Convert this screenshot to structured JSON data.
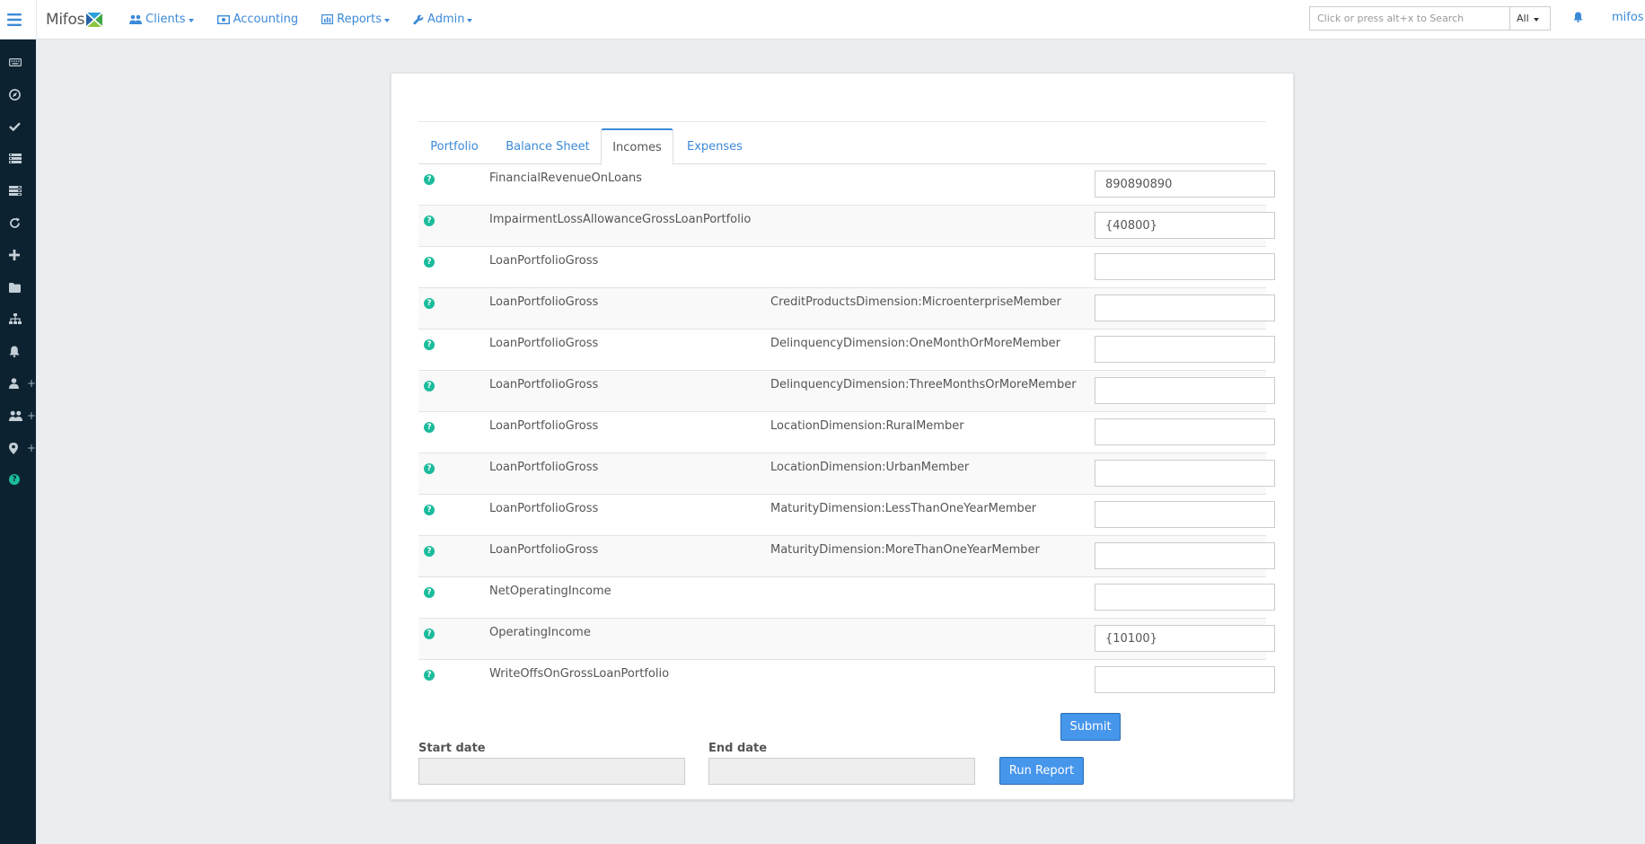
{
  "nav": {
    "brand": "Mifos",
    "items": [
      {
        "label": "Clients",
        "icon": "users-icon"
      },
      {
        "label": "Accounting",
        "icon": "money-icon"
      },
      {
        "label": "Reports",
        "icon": "bar-chart-icon"
      },
      {
        "label": "Admin",
        "icon": "wrench-icon"
      }
    ],
    "search_placeholder": "Click or press alt+x to Search",
    "search_scope": "All",
    "user": "mifos"
  },
  "sidebar": {
    "icons": [
      "keyboard-icon",
      "compass-icon",
      "check-icon",
      "list-icon",
      "list-alt-icon",
      "refresh-icon",
      "plus-icon",
      "folder-icon",
      "sitemap-icon",
      "bell-icon",
      "user-plus-icon",
      "users-plus-icon",
      "map-marker-plus-icon",
      "question-icon"
    ]
  },
  "tabs": [
    {
      "label": "Portfolio",
      "active": false
    },
    {
      "label": "Balance Sheet",
      "active": false
    },
    {
      "label": "Incomes",
      "active": true
    },
    {
      "label": "Expenses",
      "active": false
    }
  ],
  "rows": [
    {
      "concept": "FinancialRevenueOnLoans",
      "dimension": "",
      "value": "890890890"
    },
    {
      "concept": "ImpairmentLossAllowanceGrossLoanPortfolio",
      "dimension": "",
      "value": "{40800}"
    },
    {
      "concept": "LoanPortfolioGross",
      "dimension": "",
      "value": ""
    },
    {
      "concept": "LoanPortfolioGross",
      "dimension": "CreditProductsDimension:MicroenterpriseMember",
      "value": ""
    },
    {
      "concept": "LoanPortfolioGross",
      "dimension": "DelinquencyDimension:OneMonthOrMoreMember",
      "value": ""
    },
    {
      "concept": "LoanPortfolioGross",
      "dimension": "DelinquencyDimension:ThreeMonthsOrMoreMember",
      "value": ""
    },
    {
      "concept": "LoanPortfolioGross",
      "dimension": "LocationDimension:RuralMember",
      "value": ""
    },
    {
      "concept": "LoanPortfolioGross",
      "dimension": "LocationDimension:UrbanMember",
      "value": ""
    },
    {
      "concept": "LoanPortfolioGross",
      "dimension": "MaturityDimension:LessThanOneYearMember",
      "value": ""
    },
    {
      "concept": "LoanPortfolioGross",
      "dimension": "MaturityDimension:MoreThanOneYearMember",
      "value": ""
    },
    {
      "concept": "NetOperatingIncome",
      "dimension": "",
      "value": ""
    },
    {
      "concept": "OperatingIncome",
      "dimension": "",
      "value": "{10100}"
    },
    {
      "concept": "WriteOffsOnGrossLoanPortfolio",
      "dimension": "",
      "value": ""
    }
  ],
  "form": {
    "submit_label": "Submit",
    "start_date_label": "Start date",
    "end_date_label": "End date",
    "run_report_label": "Run Report"
  },
  "colors": {
    "accent": "#3b8ad8",
    "sidebar": "#0c2230",
    "help": "#1abc9c",
    "button": "#4696ec"
  }
}
